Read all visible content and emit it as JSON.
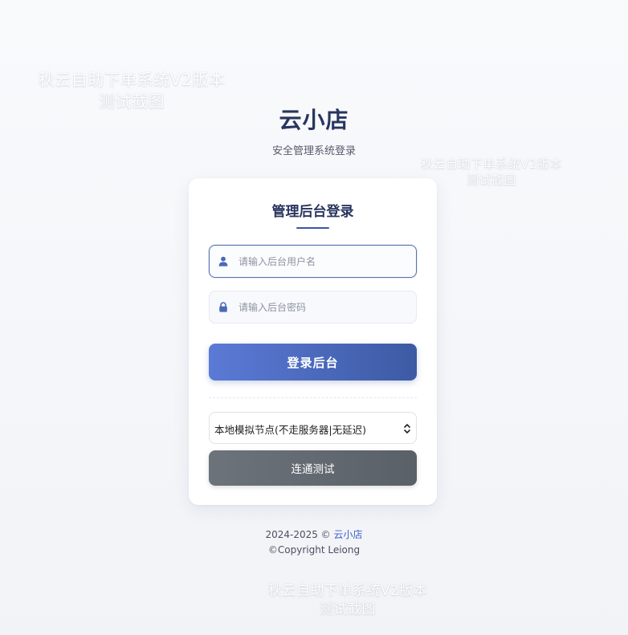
{
  "watermark": {
    "line1": "秋云自助下单系统V2版本",
    "line2": "测试截图"
  },
  "brand": {
    "title": "云小店",
    "subtitle": "安全管理系统登录"
  },
  "card": {
    "title": "管理后台登录",
    "username": {
      "value": "",
      "placeholder": "请输入后台用户名",
      "icon": "user-icon"
    },
    "password": {
      "value": "",
      "placeholder": "请输入后台密码",
      "icon": "lock-icon"
    },
    "login_label": "登录后台",
    "node_select": {
      "selected": "本地模拟节点(不走服务器|无延迟)",
      "icon": "updown-chevron-icon"
    },
    "test_label": "连通测试"
  },
  "footer": {
    "years": "2024-2025 ©",
    "brand_link": "云小店",
    "copyright": "©Copyright Leiong"
  },
  "colors": {
    "accent": "#3b57a3",
    "title": "#28355e",
    "link": "#3c62c7",
    "test_button": "#62686f"
  }
}
